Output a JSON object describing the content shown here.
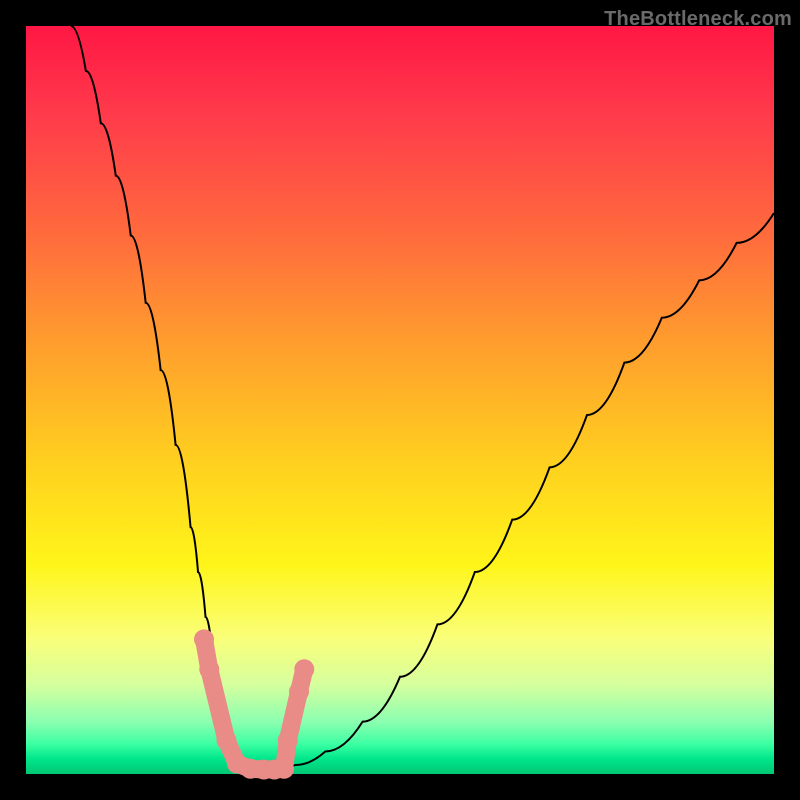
{
  "watermark": "TheBottleneck.com",
  "chart_data": {
    "type": "line",
    "title": "",
    "xlabel": "",
    "ylabel": "",
    "xlim": [
      0,
      100
    ],
    "ylim": [
      0,
      100
    ],
    "series": [
      {
        "name": "bottleneck-curve",
        "x": [
          6,
          8,
          10,
          12,
          14,
          16,
          18,
          20,
          22,
          23,
          24,
          25,
          26,
          27,
          28,
          29,
          30,
          31,
          32,
          34,
          36,
          40,
          45,
          50,
          55,
          60,
          65,
          70,
          75,
          80,
          85,
          90,
          95,
          100
        ],
        "y": [
          100,
          94,
          87,
          80,
          72,
          63,
          54,
          44,
          33,
          27,
          21,
          15,
          10,
          6,
          3,
          1.5,
          0.7,
          0.6,
          0.6,
          0.7,
          1.2,
          3,
          7,
          13,
          20,
          27,
          34,
          41,
          48,
          55,
          61,
          66,
          71,
          75
        ]
      }
    ],
    "markers": {
      "name": "highlight-points",
      "points": [
        {
          "x": 23.8,
          "y": 18
        },
        {
          "x": 24.5,
          "y": 14
        },
        {
          "x": 26.8,
          "y": 4.5
        },
        {
          "x": 28.2,
          "y": 1.4
        },
        {
          "x": 30.0,
          "y": 0.7
        },
        {
          "x": 31.8,
          "y": 0.6
        },
        {
          "x": 33.2,
          "y": 0.6
        },
        {
          "x": 34.5,
          "y": 0.7
        },
        {
          "x": 35.0,
          "y": 4.5
        },
        {
          "x": 36.5,
          "y": 11
        },
        {
          "x": 37.2,
          "y": 14
        }
      ]
    },
    "gradient_stops": [
      {
        "pos": 0,
        "color": "#ff1744"
      },
      {
        "pos": 12,
        "color": "#ff3b4b"
      },
      {
        "pos": 28,
        "color": "#ff6b3d"
      },
      {
        "pos": 42,
        "color": "#ff9c2e"
      },
      {
        "pos": 58,
        "color": "#ffcf1f"
      },
      {
        "pos": 72,
        "color": "#fff51a"
      },
      {
        "pos": 82,
        "color": "#f9ff7a"
      },
      {
        "pos": 88,
        "color": "#d6ff9e"
      },
      {
        "pos": 93,
        "color": "#8cffb0"
      },
      {
        "pos": 96,
        "color": "#3cffa3"
      },
      {
        "pos": 98,
        "color": "#00e68a"
      },
      {
        "pos": 100,
        "color": "#00c774"
      }
    ]
  }
}
